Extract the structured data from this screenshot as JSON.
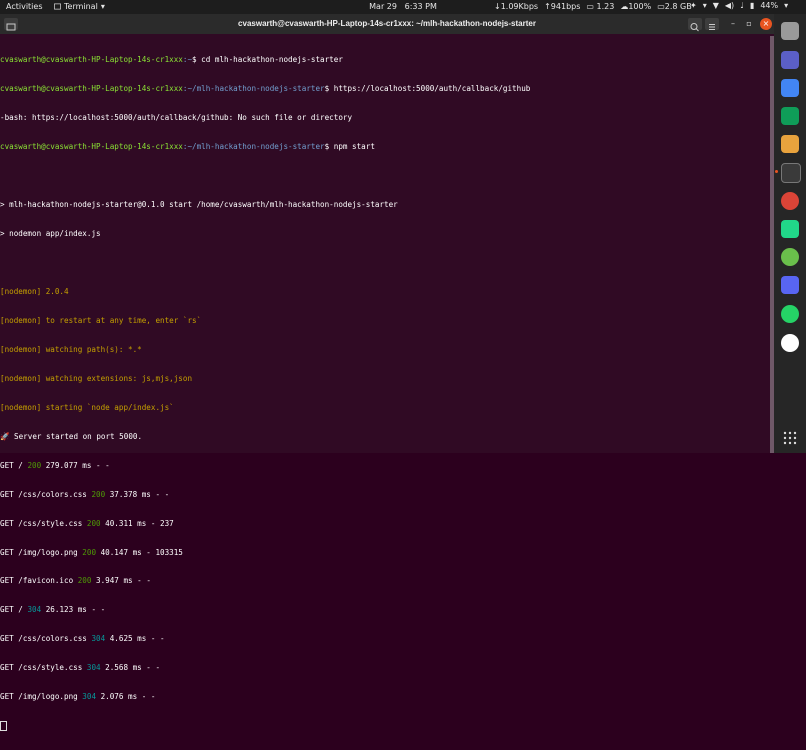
{
  "topbar": {
    "activities": "Activities",
    "app": "Terminal",
    "date": "Mar 29",
    "time": "6:33 PM",
    "net_down": "↓1.09Kbps",
    "net_up": "↑941bps",
    "load": "1.23",
    "cloud": "100%",
    "disk": "2.8 GB",
    "battery": "44%"
  },
  "window": {
    "title": "cvaswarth@cvaswarth-HP-Laptop-14s-cr1xxx: ~/mlh-hackathon-nodejs-starter"
  },
  "terminal": {
    "prompt_user": "cvaswarth@cvaswarth-HP-Laptop-14s-cr1xxx",
    "prompt_home": ":~",
    "prompt_dir": ":~/mlh-hackathon-nodejs-starter",
    "cmd1": "$ cd mlh-hackathon-nodejs-starter",
    "cmd2": "$ https://localhost:5000/auth/callback/github",
    "err": "-bash: https://localhost:5000/auth/callback/github: No such file or directory",
    "cmd3": "$ npm start",
    "npm1": "> mlh-hackathon-nodejs-starter@0.1.0 start /home/cvaswarth/mlh-hackathon-nodejs-starter",
    "npm2": "> nodemon app/index.js",
    "nodemon": [
      "[nodemon] 2.0.4",
      "[nodemon] to restart at any time, enter `rs`",
      "[nodemon] watching path(s): *.*",
      "[nodemon] watching extensions: js,mjs,json",
      "[nodemon] starting `node app/index.js`"
    ],
    "server": "🚀 Server started on port 5000.",
    "requests": [
      {
        "req": "GET / ",
        "code": "200",
        "rest": " 279.077 ms - -"
      },
      {
        "req": "GET /css/colors.css ",
        "code": "200",
        "rest": " 37.378 ms - -"
      },
      {
        "req": "GET /css/style.css ",
        "code": "200",
        "rest": " 40.311 ms - 237"
      },
      {
        "req": "GET /img/logo.png ",
        "code": "200",
        "rest": " 40.147 ms - 103315"
      },
      {
        "req": "GET /favicon.ico ",
        "code": "200",
        "rest": " 3.947 ms - -"
      },
      {
        "req": "GET / ",
        "code": "304",
        "rest": " 26.123 ms - -"
      },
      {
        "req": "GET /css/colors.css ",
        "code": "304",
        "rest": " 4.625 ms - -"
      },
      {
        "req": "GET /css/style.css ",
        "code": "304",
        "rest": " 2.568 ms - -"
      },
      {
        "req": "GET /img/logo.png ",
        "code": "304",
        "rest": " 2.076 ms - -"
      }
    ]
  },
  "dock": [
    {
      "name": "files-icon",
      "color": "#9a9a9a"
    },
    {
      "name": "teams-icon",
      "color": "#5b5fc7"
    },
    {
      "name": "docs-icon",
      "color": "#4285f4"
    },
    {
      "name": "sheets-icon",
      "color": "#0f9d58"
    },
    {
      "name": "layers-icon",
      "color": "#e8a33d"
    },
    {
      "name": "terminal-icon",
      "color": "#3a3a3a"
    },
    {
      "name": "chrome-icon",
      "color": "#db4437"
    },
    {
      "name": "pycharm-icon",
      "color": "#21d789"
    },
    {
      "name": "disk-icon",
      "color": "#6abf4b"
    },
    {
      "name": "discord-icon",
      "color": "#5865f2"
    },
    {
      "name": "whatsapp-icon",
      "color": "#25d366"
    },
    {
      "name": "app-icon",
      "color": "#ffffff"
    }
  ]
}
